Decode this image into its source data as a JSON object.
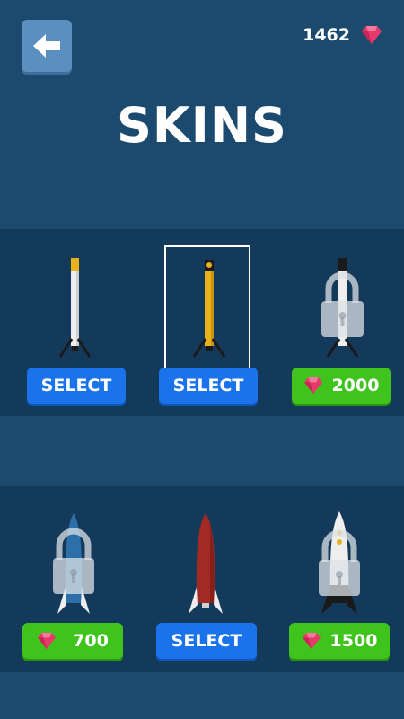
{
  "header": {
    "back_icon": "arrow-left-icon",
    "gem_count": "1462",
    "gem_icon": "ruby-gem-icon"
  },
  "title": "SKINS",
  "skins": [
    {
      "button_label": "SELECT",
      "button_type": "select",
      "locked": false,
      "selected": false,
      "price": ""
    },
    {
      "button_label": "SELECT",
      "button_type": "select",
      "locked": false,
      "selected": true,
      "price": ""
    },
    {
      "button_label": "2000",
      "button_type": "buy",
      "locked": true,
      "selected": false,
      "price": "2000"
    },
    {
      "button_label": "700",
      "button_type": "buy",
      "locked": true,
      "selected": false,
      "price": "700"
    },
    {
      "button_label": "SELECT",
      "button_type": "select",
      "locked": false,
      "selected": false,
      "price": ""
    },
    {
      "button_label": "1500",
      "button_type": "buy",
      "locked": true,
      "selected": false,
      "price": "1500"
    }
  ],
  "colors": {
    "background": "#1b4a6e",
    "shelf": "#143a5b",
    "select_button": "#1a73ea",
    "buy_button": "#3ec41c",
    "gem": "#e83a6a"
  }
}
